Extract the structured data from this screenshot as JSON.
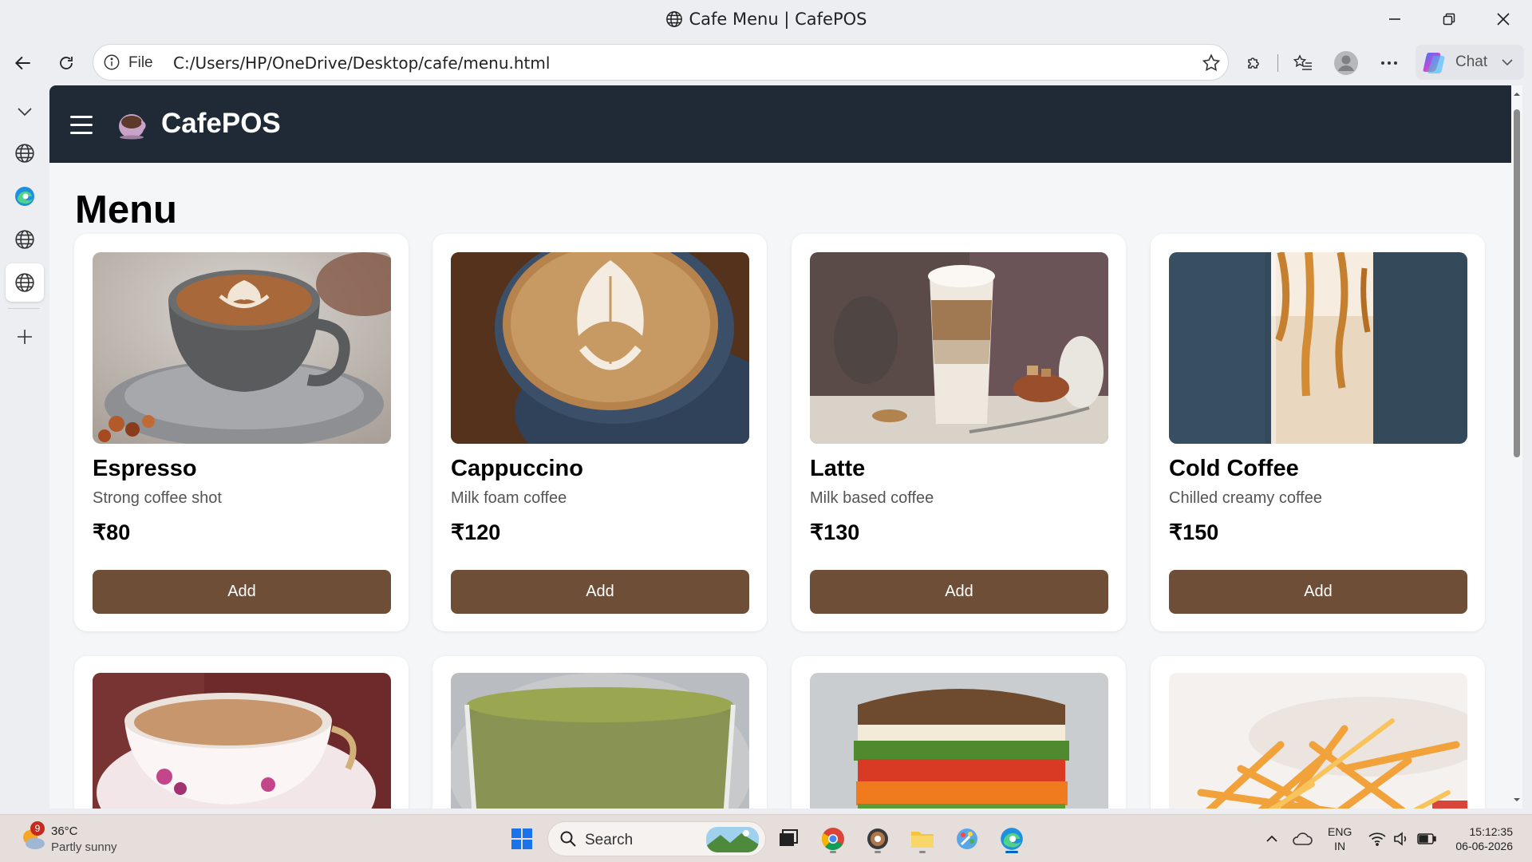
{
  "window": {
    "title": "Cafe Menu | CafePOS"
  },
  "addressbar": {
    "scheme": "File",
    "url": "C:/Users/HP/OneDrive/Desktop/cafe/menu.html",
    "copilot_label": "Chat"
  },
  "app": {
    "brand": "CafePOS",
    "page_title": "Menu"
  },
  "menu_items": [
    {
      "name": "Espresso",
      "description": "Strong coffee shot",
      "price": "₹80",
      "button": "Add",
      "image": "latte-art-cup-on-saucer"
    },
    {
      "name": "Cappuccino",
      "description": "Milk foam coffee",
      "price": "₹120",
      "button": "Add",
      "image": "cappuccino-foam-art"
    },
    {
      "name": "Latte",
      "description": "Milk based coffee",
      "price": "₹130",
      "button": "Add",
      "image": "layered-latte-glass"
    },
    {
      "name": "Cold Coffee",
      "description": "Chilled creamy coffee",
      "price": "₹150",
      "button": "Add",
      "image": "caramel-cold-coffee"
    },
    {
      "image": "masala-tea-cup"
    },
    {
      "image": "green-tea-glass"
    },
    {
      "image": "veg-sandwich"
    },
    {
      "image": "french-fries"
    }
  ],
  "colors": {
    "header_bg": "#1f2a36",
    "add_button": "#6f4e37",
    "page_bg": "#f5f6f8"
  },
  "taskbar": {
    "weather_badge": "9",
    "temperature": "36°C",
    "condition": "Partly sunny",
    "search_label": "Search",
    "lang_line1": "ENG",
    "lang_line2": "IN",
    "time": "15:12:35",
    "date": "06-06-2026"
  }
}
